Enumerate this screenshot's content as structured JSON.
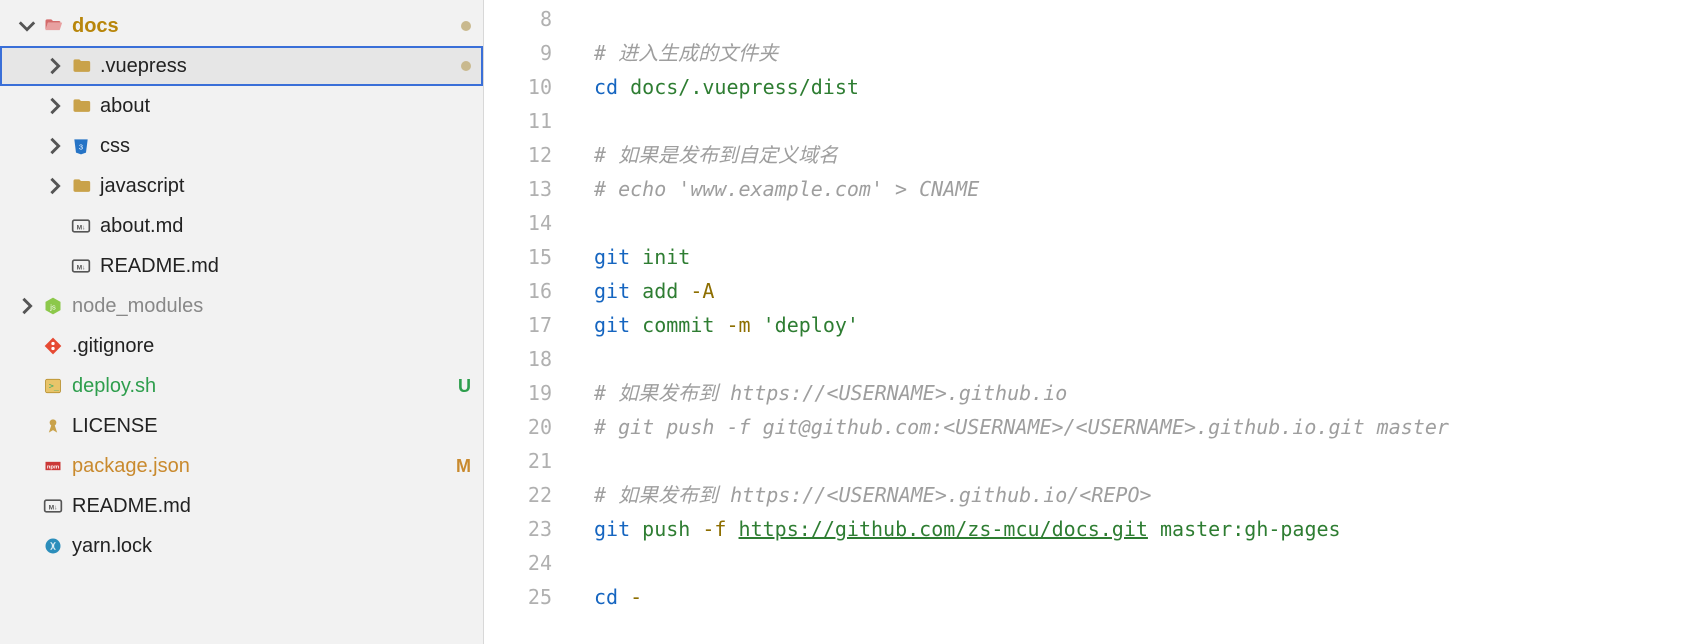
{
  "sidebar": {
    "items": [
      {
        "depth": 0,
        "chevron": "down",
        "iconType": "folder-open-red",
        "label": "docs",
        "labelClass": "folder-open",
        "status": "dot",
        "selected": false
      },
      {
        "depth": 1,
        "chevron": "right",
        "iconType": "folder",
        "label": ".vuepress",
        "labelClass": "",
        "status": "dot",
        "selected": true
      },
      {
        "depth": 1,
        "chevron": "right",
        "iconType": "folder",
        "label": "about",
        "labelClass": "",
        "status": "",
        "selected": false
      },
      {
        "depth": 1,
        "chevron": "right",
        "iconType": "css-folder",
        "label": "css",
        "labelClass": "",
        "status": "",
        "selected": false
      },
      {
        "depth": 1,
        "chevron": "right",
        "iconType": "folder",
        "label": "javascript",
        "labelClass": "",
        "status": "",
        "selected": false
      },
      {
        "depth": 1,
        "chevron": "",
        "iconType": "md",
        "label": "about.md",
        "labelClass": "",
        "status": "",
        "selected": false
      },
      {
        "depth": 1,
        "chevron": "",
        "iconType": "md",
        "label": "README.md",
        "labelClass": "",
        "status": "",
        "selected": false
      },
      {
        "depth": 0,
        "chevron": "right",
        "iconType": "node",
        "label": "node_modules",
        "labelClass": "dim",
        "status": "",
        "selected": false
      },
      {
        "depth": 0,
        "chevron": "",
        "iconType": "git",
        "label": ".gitignore",
        "labelClass": "",
        "status": "",
        "selected": false
      },
      {
        "depth": 0,
        "chevron": "",
        "iconType": "sh",
        "label": "deploy.sh",
        "labelClass": "git-green",
        "status": "U",
        "selected": false
      },
      {
        "depth": 0,
        "chevron": "",
        "iconType": "license",
        "label": "LICENSE",
        "labelClass": "",
        "status": "",
        "selected": false
      },
      {
        "depth": 0,
        "chevron": "",
        "iconType": "npm",
        "label": "package.json",
        "labelClass": "git-orange",
        "status": "M",
        "selected": false
      },
      {
        "depth": 0,
        "chevron": "",
        "iconType": "md",
        "label": "README.md",
        "labelClass": "",
        "status": "",
        "selected": false
      },
      {
        "depth": 0,
        "chevron": "",
        "iconType": "yarn",
        "label": "yarn.lock",
        "labelClass": "",
        "status": "",
        "selected": false
      }
    ]
  },
  "editor": {
    "startLine": 8,
    "lines": [
      {
        "n": 8,
        "tokens": []
      },
      {
        "n": 9,
        "tokens": [
          {
            "t": "# 进入生成的文件夹",
            "c": "comment"
          }
        ]
      },
      {
        "n": 10,
        "tokens": [
          {
            "t": "cd",
            "c": "cmd"
          },
          {
            "t": " ",
            "c": "plain"
          },
          {
            "t": "docs/.vuepress/dist",
            "c": "arg"
          }
        ]
      },
      {
        "n": 11,
        "tokens": []
      },
      {
        "n": 12,
        "tokens": [
          {
            "t": "# 如果是发布到自定义域名",
            "c": "comment"
          }
        ]
      },
      {
        "n": 13,
        "tokens": [
          {
            "t": "# echo 'www.example.com' > CNAME",
            "c": "comment"
          }
        ]
      },
      {
        "n": 14,
        "tokens": []
      },
      {
        "n": 15,
        "tokens": [
          {
            "t": "git",
            "c": "cmd"
          },
          {
            "t": " ",
            "c": "plain"
          },
          {
            "t": "init",
            "c": "builtin"
          }
        ]
      },
      {
        "n": 16,
        "tokens": [
          {
            "t": "git",
            "c": "cmd"
          },
          {
            "t": " ",
            "c": "plain"
          },
          {
            "t": "add",
            "c": "builtin"
          },
          {
            "t": " ",
            "c": "plain"
          },
          {
            "t": "-A",
            "c": "flag"
          }
        ]
      },
      {
        "n": 17,
        "tokens": [
          {
            "t": "git",
            "c": "cmd"
          },
          {
            "t": " ",
            "c": "plain"
          },
          {
            "t": "commit",
            "c": "builtin"
          },
          {
            "t": " ",
            "c": "plain"
          },
          {
            "t": "-m",
            "c": "flag"
          },
          {
            "t": " ",
            "c": "plain"
          },
          {
            "t": "'deploy'",
            "c": "str"
          }
        ]
      },
      {
        "n": 18,
        "tokens": []
      },
      {
        "n": 19,
        "tokens": [
          {
            "t": "# 如果发布到 https://<USERNAME>.github.io",
            "c": "comment"
          }
        ]
      },
      {
        "n": 20,
        "tokens": [
          {
            "t": "# git push -f git@github.com:<USERNAME>/<USERNAME>.github.io.git master",
            "c": "comment"
          }
        ]
      },
      {
        "n": 21,
        "tokens": []
      },
      {
        "n": 22,
        "tokens": [
          {
            "t": "# 如果发布到 https://<USERNAME>.github.io/<REPO>",
            "c": "comment"
          }
        ]
      },
      {
        "n": 23,
        "tokens": [
          {
            "t": "git",
            "c": "cmd"
          },
          {
            "t": " ",
            "c": "plain"
          },
          {
            "t": "push",
            "c": "builtin"
          },
          {
            "t": " ",
            "c": "plain"
          },
          {
            "t": "-f",
            "c": "flag"
          },
          {
            "t": " ",
            "c": "plain"
          },
          {
            "t": "https://github.com/zs-mcu/docs.git",
            "c": "url"
          },
          {
            "t": " ",
            "c": "plain"
          },
          {
            "t": "master:gh-pages",
            "c": "builtin"
          }
        ]
      },
      {
        "n": 24,
        "tokens": []
      },
      {
        "n": 25,
        "tokens": [
          {
            "t": "cd",
            "c": "cmd"
          },
          {
            "t": " ",
            "c": "plain"
          },
          {
            "t": "-",
            "c": "flag"
          }
        ]
      }
    ]
  }
}
